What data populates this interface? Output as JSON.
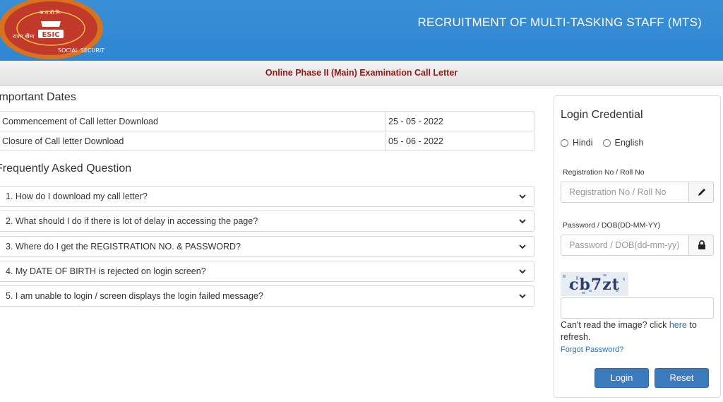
{
  "header": {
    "title": "RECRUITMENT OF MULTI-TASKING STAFF (MTS)",
    "logo": {
      "center_text": "ESIC",
      "ring_text_left": "राज्य बीमा",
      "ring_text_right": "SOCIAL SECURITY",
      "top_text": "क.रा.बी.नि."
    }
  },
  "subbar": {
    "title": "Online Phase II (Main) Examination Call Letter"
  },
  "important_dates": {
    "title": "Important Dates",
    "rows": [
      {
        "label": "Commencement of Call letter Download",
        "value": "25 - 05 - 2022"
      },
      {
        "label": "Closure of Call letter Download",
        "value": "05 - 06 - 2022"
      }
    ]
  },
  "faq": {
    "title": "Frequently Asked Question",
    "items": [
      "1. How do I download my call letter?",
      "2. What should I do if there is lot of delay in accessing the page?",
      "3. Where do I get the REGISTRATION NO. & PASSWORD?",
      "4. My DATE OF BIRTH is rejected on login screen?",
      "5. I am unable to login / screen displays the login failed message?"
    ]
  },
  "login": {
    "title": "Login Credential",
    "lang_hindi": "Hindi",
    "lang_english": "English",
    "reg_label": "Registration No / Roll No",
    "reg_placeholder": "Registration No / Roll No",
    "pwd_label": "Password / DOB(DD-MM-YY)",
    "pwd_placeholder": "Password / DOB(dd-mm-yy)",
    "captcha_text": "cb7zt",
    "help_prefix": "Can't read the image? click ",
    "help_link": "here",
    "help_suffix": " to refresh.",
    "forgot": "Forgot Password?",
    "login_btn": "Login",
    "reset_btn": "Reset"
  },
  "colors": {
    "header_blue": "#2f86d2",
    "subbar_text": "#8b1a1a",
    "button_blue": "#3b7bbd",
    "link_blue": "#2a6fb5"
  }
}
